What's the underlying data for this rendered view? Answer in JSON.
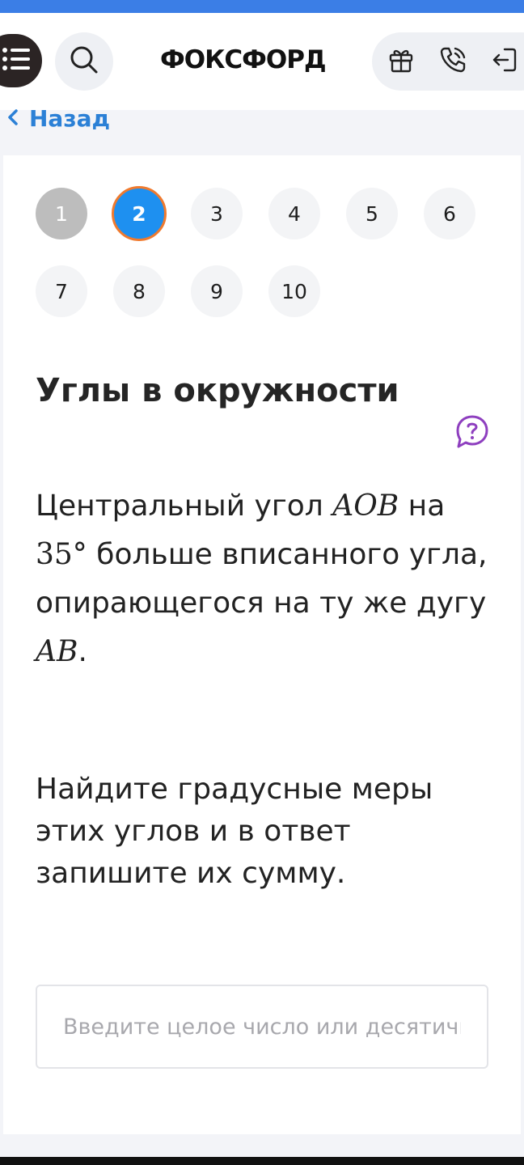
{
  "header": {
    "logo": "ФОКСФОРД",
    "icons": [
      "menu-icon",
      "search-icon",
      "gift-icon",
      "phone-icon",
      "logout-icon"
    ]
  },
  "nav": {
    "back_label": "Назад"
  },
  "questions": {
    "numbers": [
      "1",
      "2",
      "3",
      "4",
      "5",
      "6",
      "7",
      "8",
      "9",
      "10"
    ],
    "completed": 1,
    "current": 2
  },
  "topic": {
    "title": "Углы в окружности"
  },
  "task": {
    "p1_a": "Центральный угол ",
    "p1_m1": "AOB",
    "p1_b": " на ",
    "p1_m2": "35°",
    "p1_c": " больше вписанного угла, опирающегося на ту же дугу ",
    "p1_m3": "AB",
    "p1_d": ".",
    "p2": "Найдите градусные меры этих углов и в ответ запишите их сумму."
  },
  "answer": {
    "placeholder": "Введите целое число или десятичную дробь",
    "value": ""
  },
  "colors": {
    "accent_blue": "#1e90f0",
    "active_ring": "#f07a2e",
    "link": "#2b80d6",
    "help": "#8e3fbf",
    "top_bar": "#3b7ee6"
  }
}
